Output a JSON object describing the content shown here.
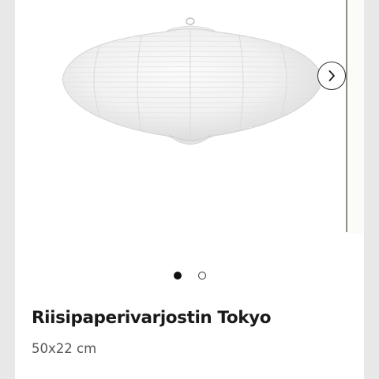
{
  "product": {
    "title": "Riisipaperivarjostin Tokyo",
    "size": "50x22 cm"
  },
  "carousel": {
    "slide_count": 2,
    "active_slide": 1,
    "next_icon": "chevron-right-icon",
    "image_subject": "lamp-shade-image"
  },
  "colors": {
    "page_background": "#e9e9e9",
    "card_background": "#ffffff",
    "title_text": "#1a1a1a",
    "size_text": "#555555",
    "dot_active": "#111111"
  }
}
